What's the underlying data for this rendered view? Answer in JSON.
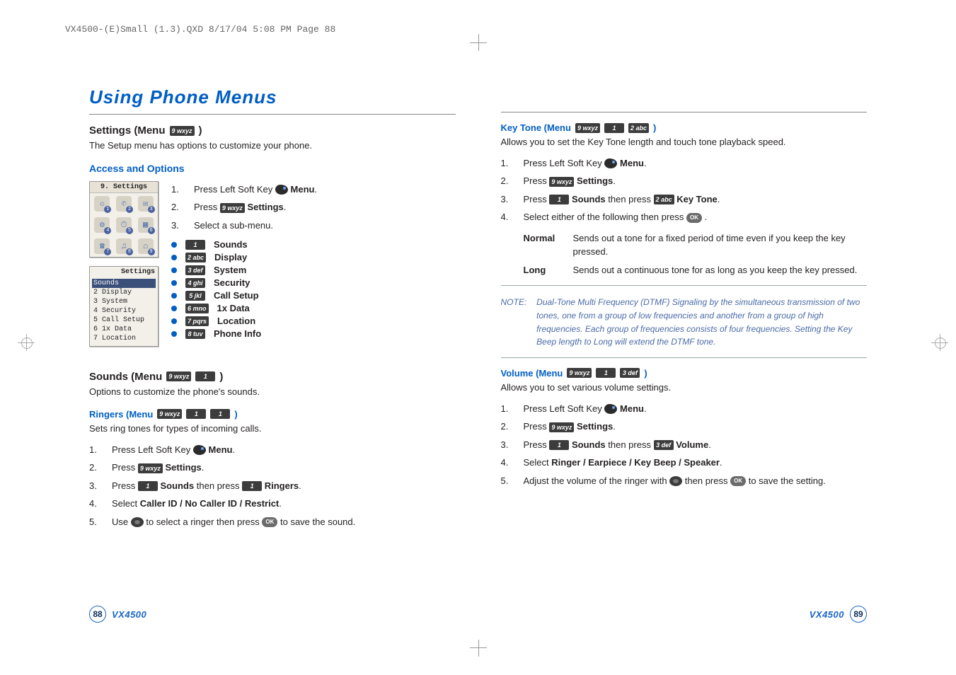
{
  "slug": "VX4500-(E)Small (1.3).QXD  8/17/04  5:08 PM  Page 88",
  "chapter": "Using Phone Menus",
  "left": {
    "settings_title_prefix": "Settings (Menu ",
    "settings_title_suffix": " )",
    "settings_desc": "The Setup menu has options to customize your phone.",
    "access_heading": "Access and Options",
    "steps": [
      {
        "num": "1.",
        "pre": "Press Left Soft Key ",
        "post": " "
      },
      {
        "num": "2.",
        "pre": "Press ",
        "post": " "
      },
      {
        "num": "3.",
        "pre": "Select a sub-menu.",
        "post": ""
      }
    ],
    "menu_label_1": "Menu",
    "settings_label": "Settings",
    "submenus": [
      {
        "key": "1",
        "label": "Sounds"
      },
      {
        "key": "2 abc",
        "label": "Display"
      },
      {
        "key": "3 def",
        "label": "System"
      },
      {
        "key": "4 ghi",
        "label": "Security"
      },
      {
        "key": "5 jkl",
        "label": "Call Setup"
      },
      {
        "key": "6 mno",
        "label": "1x Data"
      },
      {
        "key": "7 pqrs",
        "label": "Location"
      },
      {
        "key": "8 tuv",
        "label": "Phone Info"
      }
    ],
    "phoneshot1": {
      "title": "9. Settings",
      "icons": [
        [
          "☼",
          "1"
        ],
        [
          "✆",
          "2"
        ],
        [
          "✉",
          "3"
        ],
        [
          "⚙",
          "4"
        ],
        [
          "⏱",
          "5"
        ],
        [
          "▦",
          "6"
        ],
        [
          "☎",
          "7"
        ],
        [
          "♫",
          "8"
        ],
        [
          "⌂",
          "9"
        ]
      ]
    },
    "phoneshot2": {
      "banner": "Settings",
      "items": [
        "Sounds",
        "Display",
        "System",
        "Security",
        "Call Setup",
        "1x Data",
        "Location"
      ]
    },
    "sounds_title_pre": "Sounds (Menu ",
    "sounds_title_suf": " )",
    "sounds_desc": "Options to customize the phone's sounds.",
    "ringers_title_pre": "Ringers (Menu ",
    "ringers_title_suf": " )",
    "ringers_desc": "Sets ring tones for types of incoming calls.",
    "ringers_steps": [
      {
        "num": "1.",
        "text_pre": "Press Left Soft Key ",
        "text_post": " "
      },
      {
        "num": "2.",
        "text_pre": "Press ",
        "text_post": " "
      },
      {
        "num": "3.",
        "text_pre": "Press ",
        "mid": " ",
        "then": " then press ",
        "text_post2": " "
      },
      {
        "num": "4.",
        "text": "Select "
      },
      {
        "num": "5.",
        "text_pre": "Use ",
        "text_mid": " to select a ringer then press ",
        "text_post": " to save the sound."
      }
    ],
    "ringers_bold": {
      "sounds": "Sounds",
      "ringers": "Ringers",
      "menu": "Menu",
      "settings": "Settings"
    },
    "ringers_step4_opts": "Caller ID / No Caller ID / Restrict"
  },
  "right": {
    "keytone_title_pre": "Key Tone (Menu ",
    "keytone_title_suf": " )",
    "keytone_desc": "Allows you to set the Key Tone length and touch tone playback speed.",
    "kt_steps": [
      {
        "num": "1.",
        "pre": "Press Left Soft Key "
      },
      {
        "num": "2.",
        "pre": "Press "
      },
      {
        "num": "3.",
        "pre": "Press ",
        "then": " then press "
      },
      {
        "num": "4.",
        "pre": "Select either of the following then press ",
        "suf": " ."
      }
    ],
    "kt_bold": {
      "menu": "Menu",
      "settings": "Settings",
      "sounds": "Sounds",
      "keytone": "Key Tone"
    },
    "defs": [
      {
        "term": "Normal",
        "def": "Sends out a tone for a fixed period of time even if you keep the key pressed."
      },
      {
        "term": "Long",
        "def": "Sends out a continuous tone for as long as you keep the key pressed."
      }
    ],
    "note_label": "NOTE:",
    "note_text": "Dual-Tone Multi Frequency (DTMF) Signaling by the simultaneous transmission of two tones, one from a group of low frequencies and another from a group of high frequencies. Each group of frequencies consists of four frequencies. Setting the Key Beep length to Long will extend the DTMF tone.",
    "vol_title_pre": "Volume (Menu ",
    "vol_title_suf": " )",
    "vol_desc": "Allows you to set various volume settings.",
    "vol_steps": [
      {
        "num": "1.",
        "pre": "Press Left Soft Key "
      },
      {
        "num": "2.",
        "pre": "Press "
      },
      {
        "num": "3.",
        "pre": "Press ",
        "then": " then press "
      },
      {
        "num": "4.",
        "pre": "Select "
      },
      {
        "num": "5.",
        "pre": "Adjust the volume of the ringer with ",
        "mid": " then press ",
        "suf": " to save the setting."
      }
    ],
    "vol_bold": {
      "menu": "Menu",
      "settings": "Settings",
      "sounds": "Sounds",
      "volume": "Volume",
      "opts": "Ringer / Earpiece / Key Beep / Speaker"
    }
  },
  "keys": {
    "k9": "9 wxyz",
    "k1": "1",
    "k2": "2 abc",
    "k3": "3 def",
    "ok": "OK"
  },
  "footer": {
    "model": "VX4500",
    "pl": "88",
    "pr": "89"
  }
}
